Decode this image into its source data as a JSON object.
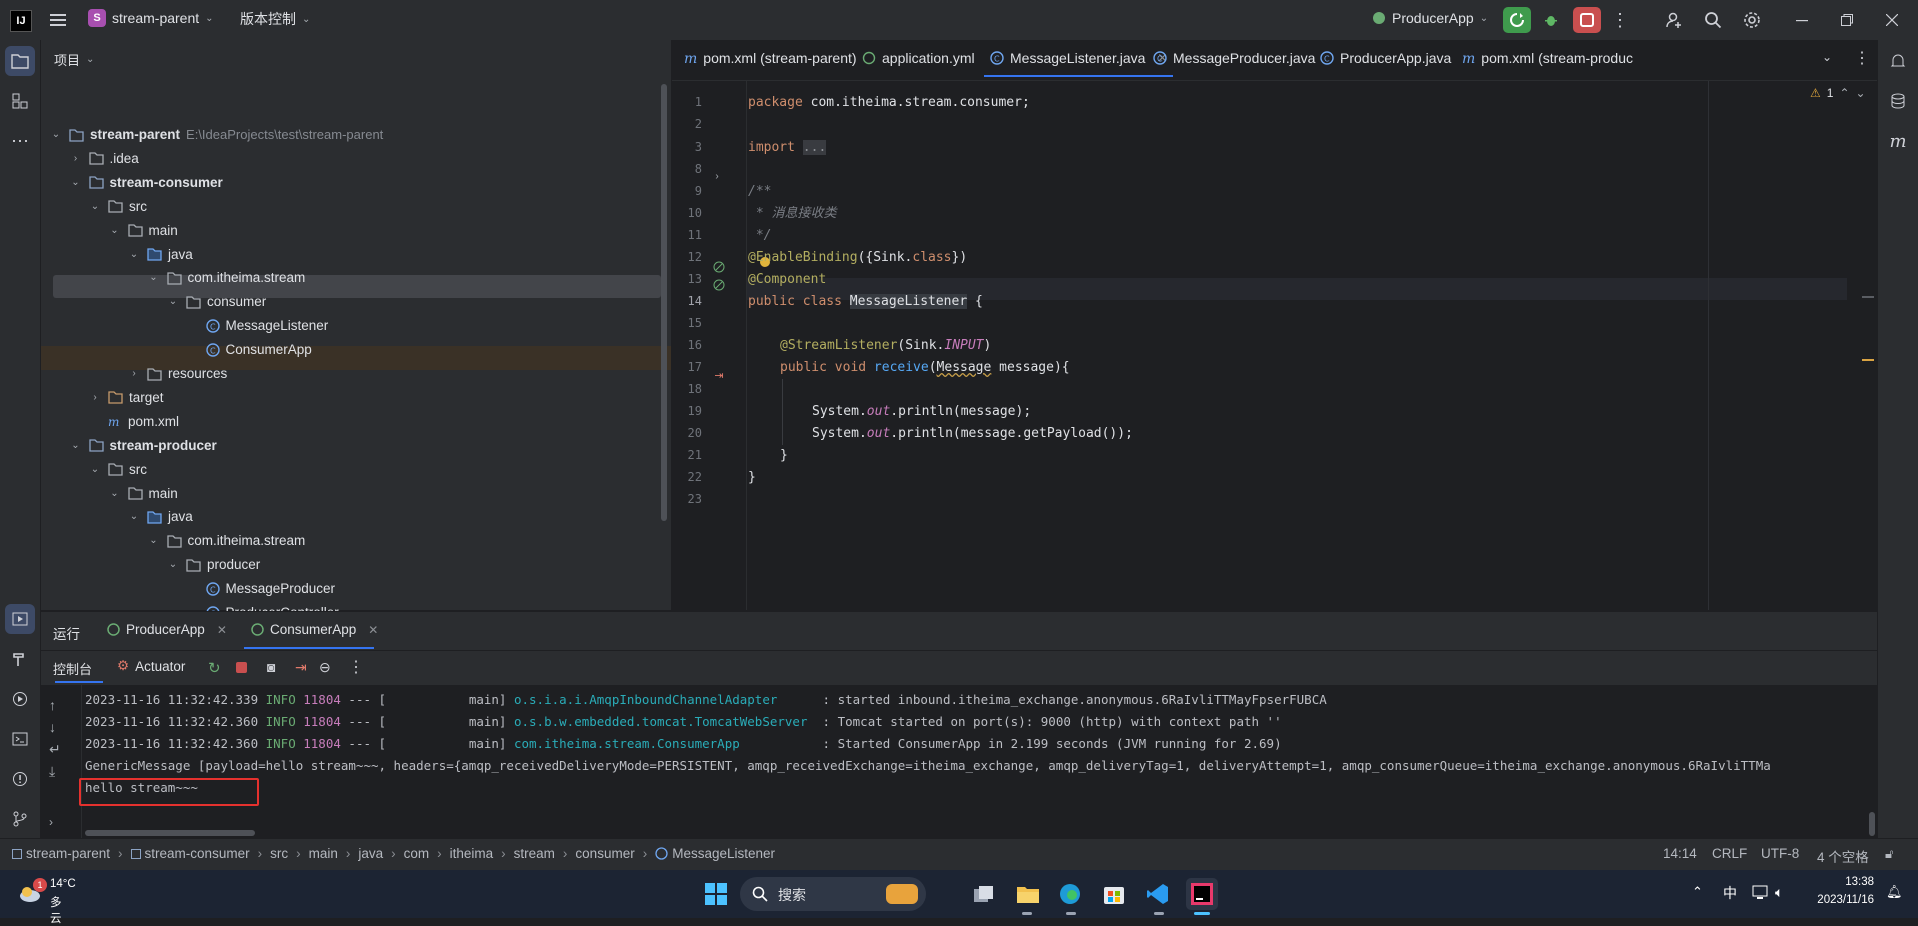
{
  "topbar": {
    "project_name": "stream-parent",
    "project_initial": "S",
    "vcs_label": "版本控制",
    "run_config": "ProducerApp"
  },
  "project_panel": {
    "title": "项目",
    "tree": [
      {
        "label": "stream-parent",
        "hint": "E:\\IdeaProjects\\test\\stream-parent",
        "icon": "module-folder-icon",
        "bold": true
      },
      {
        "label": ".idea",
        "icon": "folder-icon"
      },
      {
        "label": "stream-consumer",
        "icon": "module-folder-icon",
        "bold": true
      },
      {
        "label": "src",
        "icon": "folder-icon"
      },
      {
        "label": "main",
        "icon": "folder-icon"
      },
      {
        "label": "java",
        "icon": "source-folder-icon"
      },
      {
        "label": "com.itheima.stream",
        "icon": "package-icon"
      },
      {
        "label": "consumer",
        "icon": "package-icon"
      },
      {
        "label": "MessageListener",
        "icon": "class-icon"
      },
      {
        "label": "ConsumerApp",
        "icon": "spring-class-icon"
      },
      {
        "label": "resources",
        "icon": "resources-folder-icon"
      },
      {
        "label": "target",
        "icon": "excluded-folder-icon"
      },
      {
        "label": "pom.xml",
        "icon": "maven-icon"
      },
      {
        "label": "stream-producer",
        "icon": "module-folder-icon",
        "bold": true
      },
      {
        "label": "src",
        "icon": "folder-icon"
      },
      {
        "label": "main",
        "icon": "folder-icon"
      },
      {
        "label": "java",
        "icon": "source-folder-icon"
      },
      {
        "label": "com.itheima.stream",
        "icon": "package-icon"
      },
      {
        "label": "producer",
        "icon": "package-icon"
      },
      {
        "label": "MessageProducer",
        "icon": "class-icon"
      },
      {
        "label": "ProducerController",
        "icon": "class-icon"
      },
      {
        "label": "ProducerApp",
        "icon": "spring-class-icon"
      }
    ]
  },
  "editor": {
    "tabs": [
      {
        "label": "pom.xml (stream-parent)",
        "icon": "maven-icon"
      },
      {
        "label": "application.yml",
        "icon": "yaml-icon"
      },
      {
        "label": "MessageListener.java",
        "icon": "class-icon",
        "active": true
      },
      {
        "label": "MessageProducer.java",
        "icon": "class-icon"
      },
      {
        "label": "ProducerApp.java",
        "icon": "spring-class-icon"
      },
      {
        "label": "pom.xml (stream-produc",
        "icon": "maven-icon"
      }
    ],
    "warning_count": "1",
    "line_numbers": [
      "1",
      "2",
      "3",
      "8",
      "9",
      "10",
      "11",
      "12",
      "13",
      "14",
      "15",
      "16",
      "17",
      "18",
      "19",
      "20",
      "21",
      "22",
      "23"
    ],
    "code": {
      "l1a": "package ",
      "l1b": "com.itheima.stream.consumer;",
      "l3a": "import ",
      "l3b": "...",
      "l9": "/**",
      "l10a": " * ",
      "l10b": "消息接收类",
      "l11": " */",
      "l12a": "@EnableBinding",
      "l12b": "({Sink.",
      "l12c": "class",
      "l12d": "})",
      "l13a": "@",
      "l13b": "Component",
      "l14a": "public class ",
      "l14b": "MessageListener",
      " l14c": " {",
      "l16a": "@StreamListener",
      "l16b": "(Sink.",
      "l16c": "INPUT",
      "l16d": ")",
      "l17a": "public void ",
      "l17b": "receive",
      "l17c": "(",
      "l17d": "Message",
      "l17e": " message){",
      "l19a": "System.",
      "l19b": "out",
      "l19c": ".println(message);",
      "l20a": "System.",
      "l20b": "out",
      "l20c": ".println(message.getPayload());",
      "l21": "}",
      "l22": "}"
    }
  },
  "bottom": {
    "run_label": "运行",
    "run_tabs": [
      {
        "label": "ProducerApp"
      },
      {
        "label": "ConsumerApp"
      }
    ],
    "console_label": "控制台",
    "actuator_label": "Actuator",
    "logs": [
      {
        "ts": "2023-11-16 11:32:42.339",
        "level": "INFO",
        "pid": "11804",
        "sep": " --- [           main] ",
        "logger": "o.s.i.a.i.AmqpInboundChannelAdapter     ",
        "msg": " : started inbound.itheima_exchange.anonymous.6RaIvliTTMayFpserFUBCA"
      },
      {
        "ts": "2023-11-16 11:32:42.360",
        "level": "INFO",
        "pid": "11804",
        "sep": " --- [           main] ",
        "logger": "o.s.b.w.embedded.tomcat.TomcatWebServer ",
        "msg": " : Tomcat started on port(s): 9000 (http) with context path ''"
      },
      {
        "ts": "2023-11-16 11:32:42.360",
        "level": "INFO",
        "pid": "11804",
        "sep": " --- [           main] ",
        "logger": "com.itheima.stream.ConsumerApp          ",
        "msg": " : Started ConsumerApp in 2.199 seconds (JVM running for 2.69)"
      }
    ],
    "generic_message": "GenericMessage [payload=hello stream~~~, headers={amqp_receivedDeliveryMode=PERSISTENT, amqp_receivedExchange=itheima_exchange, amqp_deliveryTag=1, deliveryAttempt=1, amqp_consumerQueue=itheima_exchange.anonymous.6RaIvliTTMa",
    "hello_line": "hello stream~~~"
  },
  "statusbar": {
    "breadcrumb": [
      "stream-parent",
      "stream-consumer",
      "src",
      "main",
      "java",
      "com",
      "itheima",
      "stream",
      "consumer",
      "MessageListener"
    ],
    "position": "14:14",
    "line_sep": "CRLF",
    "encoding": "UTF-8",
    "indent": "4 个空格"
  },
  "taskbar": {
    "weather_temp": "14°C",
    "weather_desc": "多云",
    "weather_badge": "1",
    "search_placeholder": "搜索",
    "ime": "中",
    "time": "13:38",
    "date": "2023/11/16"
  },
  "colors": {
    "accent": "#3574f0",
    "highlight_box": "#e5312e",
    "run_green": "#3f9b4d",
    "stop_red": "#c94f4f"
  }
}
